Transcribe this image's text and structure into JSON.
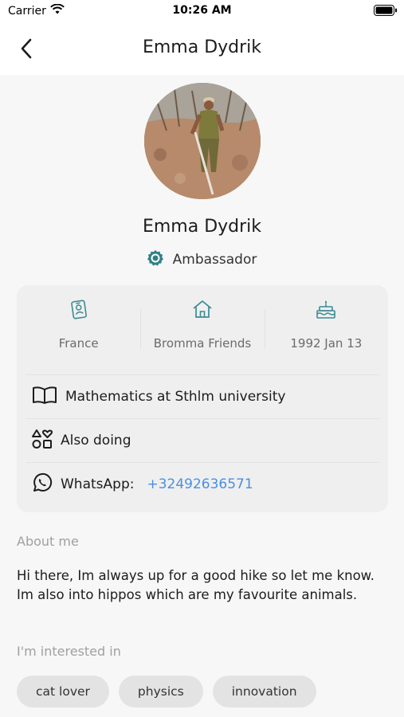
{
  "status_bar": {
    "carrier": "Carrier",
    "time": "10:26 AM"
  },
  "nav": {
    "title": "Emma Dydrik"
  },
  "profile": {
    "name": "Emma Dydrik",
    "role": "Ambassador"
  },
  "stats": [
    {
      "icon": "id-badge-icon",
      "label": "France"
    },
    {
      "icon": "home-icon",
      "label": "Bromma Friends"
    },
    {
      "icon": "birthday-cake-icon",
      "label": "1992 Jan 13"
    }
  ],
  "details": {
    "education": "Mathematics at Sthlm university",
    "also_doing": "Also doing",
    "whatsapp_label": "WhatsApp:",
    "whatsapp_number": "+32492636571"
  },
  "about": {
    "title": "About me",
    "text_line1": "Hi there, Im always up for a good hike so let me know.",
    "text_line2": "Im also into hippos which are my favourite animals."
  },
  "interests": {
    "title": "I'm interested in",
    "chips": [
      "cat lover",
      "physics",
      "innovation"
    ]
  },
  "colors": {
    "accent": "#2a8a8a",
    "link": "#4a90e2",
    "icon_teal": "#3b8b93"
  }
}
